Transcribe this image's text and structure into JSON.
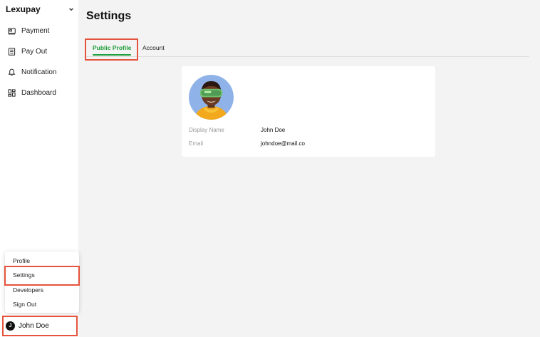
{
  "app": {
    "name": "Lexupay"
  },
  "sidebar": {
    "items": [
      {
        "label": "Payment",
        "icon": "payment-icon"
      },
      {
        "label": "Pay Out",
        "icon": "payout-icon"
      },
      {
        "label": "Notification",
        "icon": "bell-icon"
      },
      {
        "label": "Dashboard",
        "icon": "dashboard-icon"
      }
    ]
  },
  "user_menu": {
    "items": [
      "Profile",
      "Settings",
      "Developers",
      "Sign Out"
    ],
    "highlighted": "Settings"
  },
  "user": {
    "initial": "J",
    "name": "John Doe"
  },
  "page": {
    "title": "Settings"
  },
  "tabs": [
    {
      "label": "Public Profile",
      "active": true
    },
    {
      "label": "Account",
      "active": false
    }
  ],
  "profile": {
    "fields": [
      {
        "label": "Display Name",
        "value": "John Doe"
      },
      {
        "label": "Email",
        "value": "johndoe@mail.co"
      }
    ]
  },
  "colors": {
    "accent": "#1f9d3a",
    "highlight_box": "#e5533c",
    "background": "#f3f3f3",
    "card": "#ffffff"
  }
}
